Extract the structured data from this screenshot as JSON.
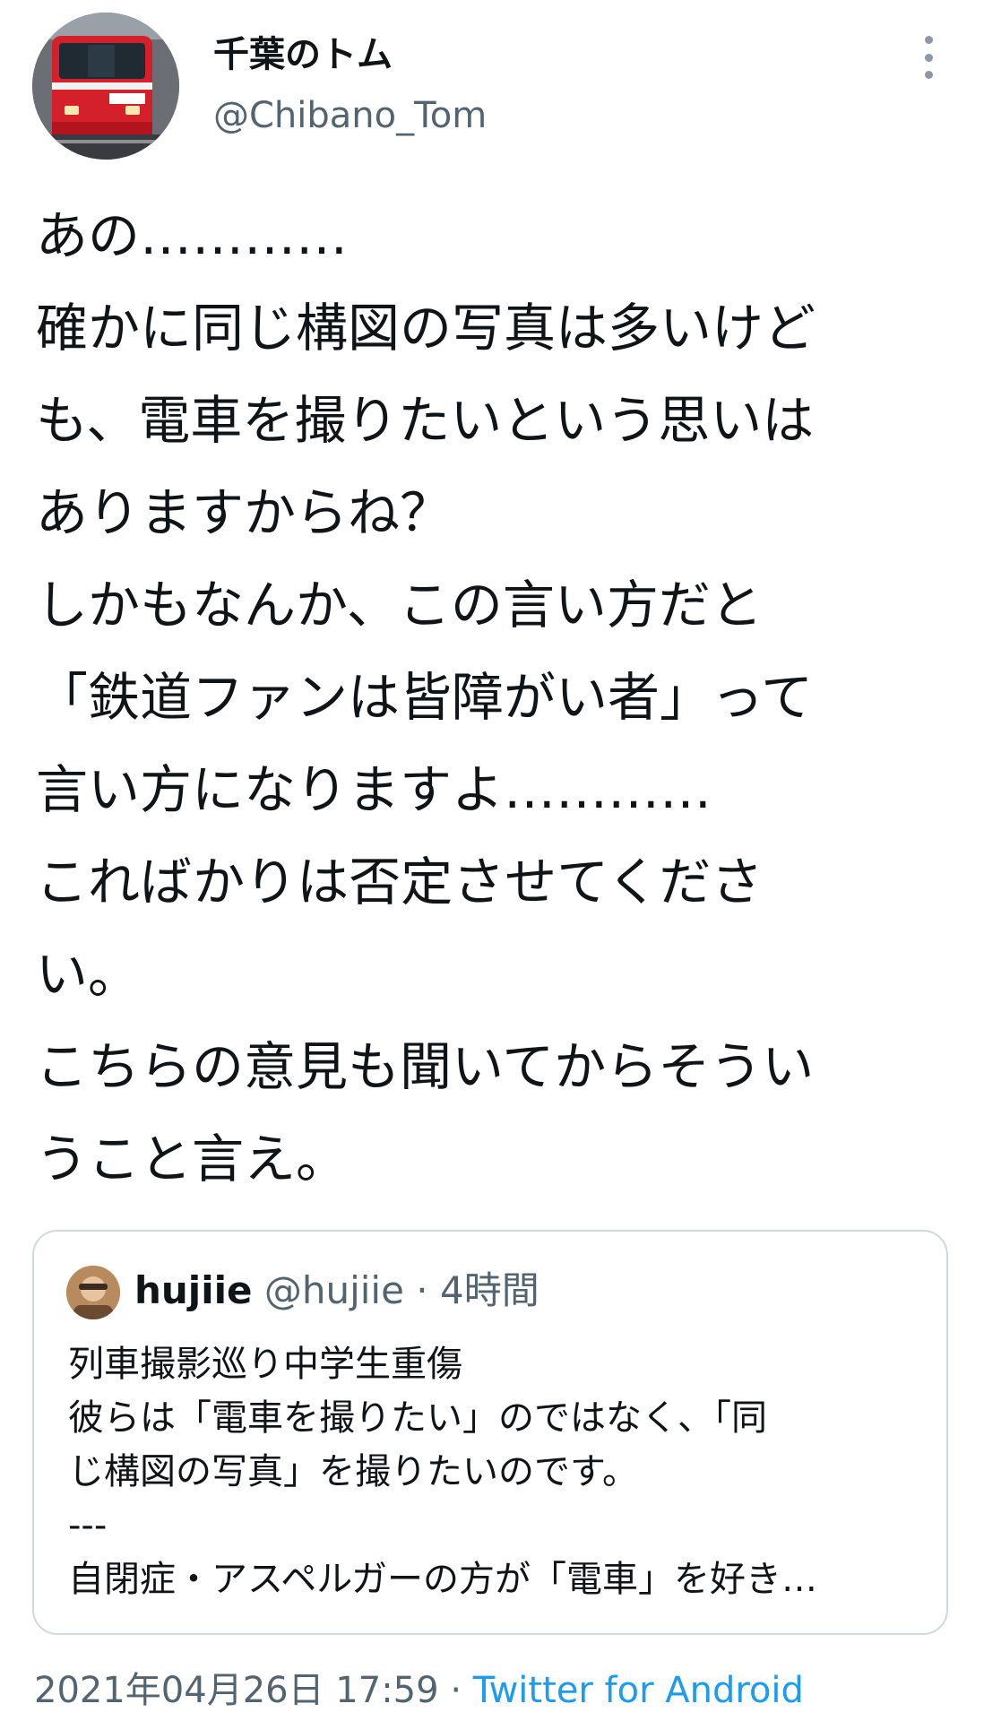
{
  "author": {
    "display_name": "千葉のトム",
    "handle": "@Chibano_Tom",
    "avatar": "train-avatar-icon"
  },
  "more_button": {
    "icon": "more-vertical-icon"
  },
  "tweet": {
    "lines": [
      "あの…………",
      "確かに同じ構図の写真は多いけど",
      "も、電車を撮りたいという思いは",
      "ありますからね？",
      "しかもなんか、この言い方だと",
      "「鉄道ファンは皆障がい者」って",
      "言い方になりますよ…………",
      "こればかりは否定させてくださ",
      "い。",
      "こちらの意見も聞いてからそうい",
      "うこと言え。"
    ]
  },
  "quote": {
    "name": "hujiie",
    "handle": "@hujiie",
    "separator": "·",
    "time": "4時間",
    "lines": [
      "列車撮影巡り中学生重傷",
      "彼らは「電車を撮りたい」のではなく、「同",
      "じ構図の写真」を撮りたいのです。",
      "---",
      "自閉症・アスペルガーの方が「電車」を好き…"
    ]
  },
  "meta": {
    "timestamp": "2021年04月26日 17:59",
    "separator": "·",
    "source": "Twitter for Android"
  },
  "colors": {
    "text": "#0f1419",
    "secondary": "#536471",
    "link": "#1d9bf0",
    "border": "#cfd9de"
  }
}
